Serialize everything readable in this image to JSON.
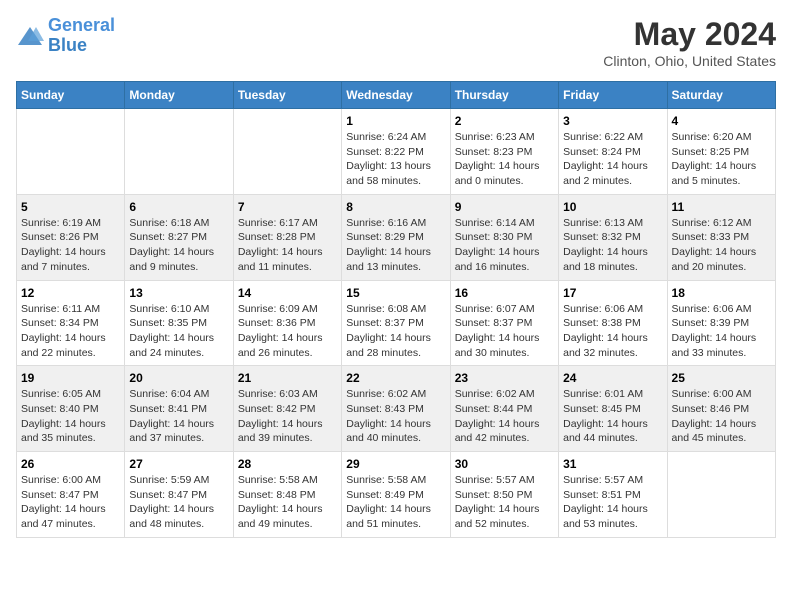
{
  "header": {
    "logo_line1": "General",
    "logo_line2": "Blue",
    "month": "May 2024",
    "location": "Clinton, Ohio, United States"
  },
  "weekdays": [
    "Sunday",
    "Monday",
    "Tuesday",
    "Wednesday",
    "Thursday",
    "Friday",
    "Saturday"
  ],
  "weeks": [
    [
      {
        "num": "",
        "info": ""
      },
      {
        "num": "",
        "info": ""
      },
      {
        "num": "",
        "info": ""
      },
      {
        "num": "1",
        "info": "Sunrise: 6:24 AM\nSunset: 8:22 PM\nDaylight: 13 hours and 58 minutes."
      },
      {
        "num": "2",
        "info": "Sunrise: 6:23 AM\nSunset: 8:23 PM\nDaylight: 14 hours and 0 minutes."
      },
      {
        "num": "3",
        "info": "Sunrise: 6:22 AM\nSunset: 8:24 PM\nDaylight: 14 hours and 2 minutes."
      },
      {
        "num": "4",
        "info": "Sunrise: 6:20 AM\nSunset: 8:25 PM\nDaylight: 14 hours and 5 minutes."
      }
    ],
    [
      {
        "num": "5",
        "info": "Sunrise: 6:19 AM\nSunset: 8:26 PM\nDaylight: 14 hours and 7 minutes."
      },
      {
        "num": "6",
        "info": "Sunrise: 6:18 AM\nSunset: 8:27 PM\nDaylight: 14 hours and 9 minutes."
      },
      {
        "num": "7",
        "info": "Sunrise: 6:17 AM\nSunset: 8:28 PM\nDaylight: 14 hours and 11 minutes."
      },
      {
        "num": "8",
        "info": "Sunrise: 6:16 AM\nSunset: 8:29 PM\nDaylight: 14 hours and 13 minutes."
      },
      {
        "num": "9",
        "info": "Sunrise: 6:14 AM\nSunset: 8:30 PM\nDaylight: 14 hours and 16 minutes."
      },
      {
        "num": "10",
        "info": "Sunrise: 6:13 AM\nSunset: 8:32 PM\nDaylight: 14 hours and 18 minutes."
      },
      {
        "num": "11",
        "info": "Sunrise: 6:12 AM\nSunset: 8:33 PM\nDaylight: 14 hours and 20 minutes."
      }
    ],
    [
      {
        "num": "12",
        "info": "Sunrise: 6:11 AM\nSunset: 8:34 PM\nDaylight: 14 hours and 22 minutes."
      },
      {
        "num": "13",
        "info": "Sunrise: 6:10 AM\nSunset: 8:35 PM\nDaylight: 14 hours and 24 minutes."
      },
      {
        "num": "14",
        "info": "Sunrise: 6:09 AM\nSunset: 8:36 PM\nDaylight: 14 hours and 26 minutes."
      },
      {
        "num": "15",
        "info": "Sunrise: 6:08 AM\nSunset: 8:37 PM\nDaylight: 14 hours and 28 minutes."
      },
      {
        "num": "16",
        "info": "Sunrise: 6:07 AM\nSunset: 8:37 PM\nDaylight: 14 hours and 30 minutes."
      },
      {
        "num": "17",
        "info": "Sunrise: 6:06 AM\nSunset: 8:38 PM\nDaylight: 14 hours and 32 minutes."
      },
      {
        "num": "18",
        "info": "Sunrise: 6:06 AM\nSunset: 8:39 PM\nDaylight: 14 hours and 33 minutes."
      }
    ],
    [
      {
        "num": "19",
        "info": "Sunrise: 6:05 AM\nSunset: 8:40 PM\nDaylight: 14 hours and 35 minutes."
      },
      {
        "num": "20",
        "info": "Sunrise: 6:04 AM\nSunset: 8:41 PM\nDaylight: 14 hours and 37 minutes."
      },
      {
        "num": "21",
        "info": "Sunrise: 6:03 AM\nSunset: 8:42 PM\nDaylight: 14 hours and 39 minutes."
      },
      {
        "num": "22",
        "info": "Sunrise: 6:02 AM\nSunset: 8:43 PM\nDaylight: 14 hours and 40 minutes."
      },
      {
        "num": "23",
        "info": "Sunrise: 6:02 AM\nSunset: 8:44 PM\nDaylight: 14 hours and 42 minutes."
      },
      {
        "num": "24",
        "info": "Sunrise: 6:01 AM\nSunset: 8:45 PM\nDaylight: 14 hours and 44 minutes."
      },
      {
        "num": "25",
        "info": "Sunrise: 6:00 AM\nSunset: 8:46 PM\nDaylight: 14 hours and 45 minutes."
      }
    ],
    [
      {
        "num": "26",
        "info": "Sunrise: 6:00 AM\nSunset: 8:47 PM\nDaylight: 14 hours and 47 minutes."
      },
      {
        "num": "27",
        "info": "Sunrise: 5:59 AM\nSunset: 8:47 PM\nDaylight: 14 hours and 48 minutes."
      },
      {
        "num": "28",
        "info": "Sunrise: 5:58 AM\nSunset: 8:48 PM\nDaylight: 14 hours and 49 minutes."
      },
      {
        "num": "29",
        "info": "Sunrise: 5:58 AM\nSunset: 8:49 PM\nDaylight: 14 hours and 51 minutes."
      },
      {
        "num": "30",
        "info": "Sunrise: 5:57 AM\nSunset: 8:50 PM\nDaylight: 14 hours and 52 minutes."
      },
      {
        "num": "31",
        "info": "Sunrise: 5:57 AM\nSunset: 8:51 PM\nDaylight: 14 hours and 53 minutes."
      },
      {
        "num": "",
        "info": ""
      }
    ]
  ]
}
